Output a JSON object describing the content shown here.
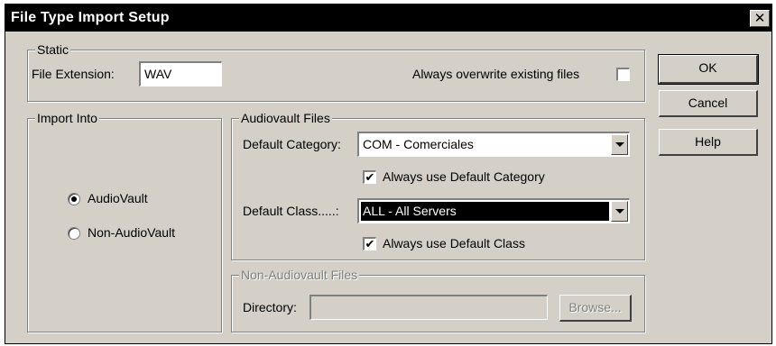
{
  "window": {
    "title": "File Type Import Setup",
    "close_glyph": "✕"
  },
  "static_group": {
    "legend": "Static",
    "file_extension_label": "File Extension:",
    "file_extension_value": "WAV",
    "overwrite_label": "Always overwrite existing files",
    "overwrite_checked": false
  },
  "import_into": {
    "legend": "Import Into",
    "options": [
      {
        "label": "AudioVault",
        "selected": true
      },
      {
        "label": "Non-AudioVault",
        "selected": false
      }
    ]
  },
  "audiovault_files": {
    "legend": "Audiovault Files",
    "default_category_label": "Default Category:",
    "default_category_value": "COM - Comerciales",
    "always_default_category_label": "Always use Default Category",
    "always_default_category_checked": true,
    "default_class_label": "Default Class.....:",
    "default_class_value": "ALL - All Servers",
    "always_default_class_label": "Always use Default Class",
    "always_default_class_checked": true
  },
  "non_audiovault_files": {
    "legend": "Non-Audiovault Files",
    "directory_label": "Directory:",
    "directory_value": "",
    "browse_label": "Browse..."
  },
  "buttons": {
    "ok": "OK",
    "cancel": "Cancel",
    "help": "Help"
  },
  "check_glyph": "✔"
}
